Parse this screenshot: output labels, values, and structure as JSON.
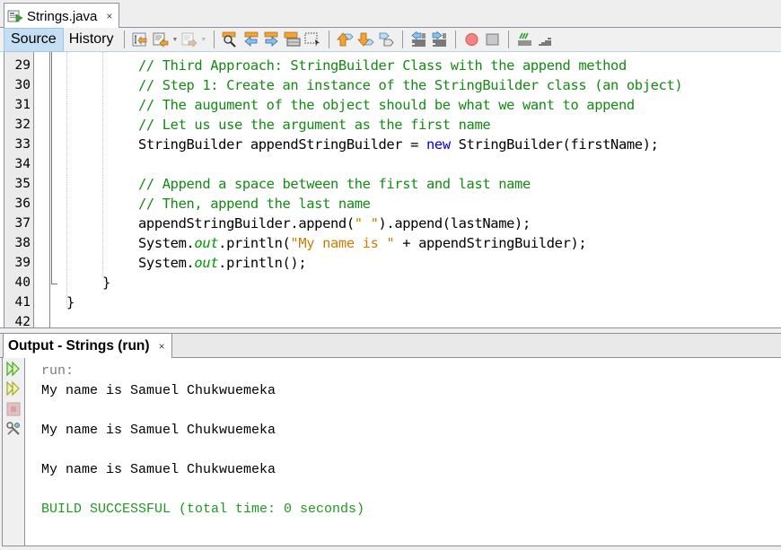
{
  "editor_tab": {
    "file_name": "Strings.java",
    "icon": "java-file-icon",
    "close_glyph": "×"
  },
  "toolbar": {
    "source_label": "Source",
    "history_label": "History",
    "buttons": [
      "last-edit-icon",
      "back-icon",
      "forward-icon",
      "find-selection-icon",
      "find-previous-icon",
      "find-next-icon",
      "toggle-highlight-icon",
      "toggle-rect-selection-icon",
      "previous-bookmark-icon",
      "next-bookmark-icon",
      "toggle-bookmark-icon",
      "shift-left-icon",
      "shift-right-icon",
      "start-macro-icon",
      "stop-macro-icon",
      "comment-icon",
      "uncomment-icon"
    ]
  },
  "code": {
    "lines": [
      {
        "n": "29",
        "segments": [
          {
            "t": "// Third Approach: StringBuilder Class with the append method",
            "k": "comment"
          }
        ]
      },
      {
        "n": "30",
        "segments": [
          {
            "t": "// Step 1: Create an instance of the StringBuilder class (an object)",
            "k": "comment"
          }
        ]
      },
      {
        "n": "31",
        "segments": [
          {
            "t": "// The augument of the object should be what we want to append",
            "k": "comment"
          }
        ]
      },
      {
        "n": "32",
        "segments": [
          {
            "t": "// Let us use the argument as the first name",
            "k": "comment"
          }
        ]
      },
      {
        "n": "33",
        "segments": [
          {
            "t": "StringBuilder appendStringBuilder = ",
            "k": "plain"
          },
          {
            "t": "new",
            "k": "kw"
          },
          {
            "t": " StringBuilder(firstName);",
            "k": "plain"
          }
        ]
      },
      {
        "n": "34",
        "segments": []
      },
      {
        "n": "35",
        "segments": [
          {
            "t": "// Append a space between the first and last name",
            "k": "comment"
          }
        ]
      },
      {
        "n": "36",
        "segments": [
          {
            "t": "// Then, append the last name",
            "k": "comment"
          }
        ]
      },
      {
        "n": "37",
        "segments": [
          {
            "t": "appendStringBuilder.append(",
            "k": "plain"
          },
          {
            "t": "\" \"",
            "k": "str"
          },
          {
            "t": ").append(lastName);",
            "k": "plain"
          }
        ]
      },
      {
        "n": "38",
        "segments": [
          {
            "t": "System.",
            "k": "plain"
          },
          {
            "t": "out",
            "k": "field"
          },
          {
            "t": ".println(",
            "k": "plain"
          },
          {
            "t": "\"My name is \"",
            "k": "str"
          },
          {
            "t": " + appendStringBuilder);",
            "k": "plain"
          }
        ]
      },
      {
        "n": "39",
        "segments": [
          {
            "t": "System.",
            "k": "plain"
          },
          {
            "t": "out",
            "k": "field"
          },
          {
            "t": ".println();",
            "k": "plain"
          }
        ]
      },
      {
        "n": "40",
        "segments": [
          {
            "t": "}",
            "k": "plain"
          }
        ],
        "indent": 1
      },
      {
        "n": "41",
        "segments": [
          {
            "t": "}",
            "k": "plain"
          }
        ],
        "indent": 0
      },
      {
        "n": "42",
        "segments": []
      }
    ]
  },
  "output": {
    "tab_title": "Output - Strings (run)",
    "close_glyph": "×",
    "side_buttons": [
      "rerun-icon",
      "rerun-with-args-icon",
      "stop-icon",
      "settings-icon"
    ],
    "lines": [
      {
        "text": "run:",
        "kind": "run"
      },
      {
        "text": "My name is Samuel Chukwuemeka",
        "kind": "normal"
      },
      {
        "text": "",
        "kind": "normal"
      },
      {
        "text": "My name is Samuel Chukwuemeka",
        "kind": "normal"
      },
      {
        "text": "",
        "kind": "normal"
      },
      {
        "text": "My name is Samuel Chukwuemeka",
        "kind": "normal"
      },
      {
        "text": "",
        "kind": "normal"
      },
      {
        "text": "BUILD SUCCESSFUL (total time: 0 seconds)",
        "kind": "success"
      }
    ]
  },
  "colors": {
    "comment": "#148a14",
    "keyword": "#0000e6",
    "string": "#ce7b00",
    "static_field": "#009900",
    "build_success": "#1e9a1e",
    "active_view_button": "#c5def4"
  }
}
